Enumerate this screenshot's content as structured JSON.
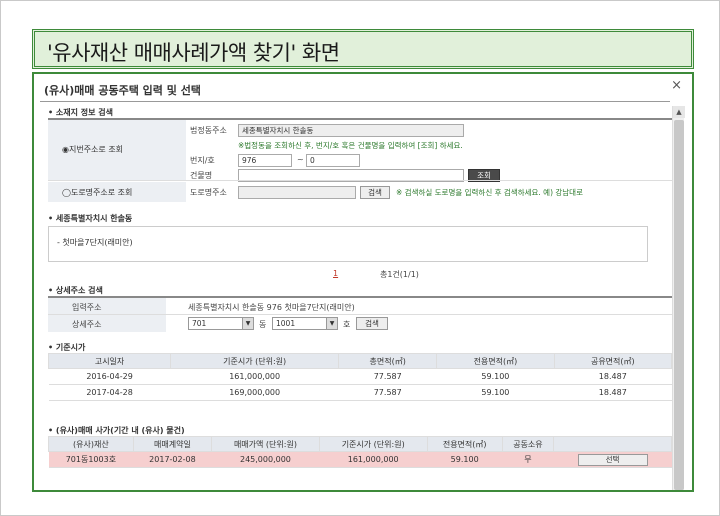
{
  "slide_title": "'유사재산 매매사례가액 찾기' 화면",
  "dialog": {
    "title": "(유사)매매 공동주택 입력 및 선택",
    "close": "×"
  },
  "section_location": {
    "title": "소재지 정보 검색",
    "radio_jibun": "◉지번주소로 조회",
    "radio_road": "◯도로명주소로 조회",
    "label_legal_dong": "법정동주소",
    "legal_dong_value": "세종특별자치시 한솔동",
    "hint_jibun": "※법정동을 조회하신 후, 번지/호 혹은 건물명을 입력하여 [조회] 하세요.",
    "label_bunji": "번지/호",
    "bunji_value": "976",
    "dash": "~",
    "ho_value": "0",
    "label_building": "건물명",
    "building_value": "",
    "search_button": "조회",
    "label_road": "도로명주소",
    "road_value": "",
    "road_search_button": "검색",
    "hint_road": "※ 검색하실 도로명을 입력하신 후 검색하세요. 예) 강남대로"
  },
  "section_region": {
    "title": "세종특별자치시 한솔동",
    "list_item": "- 첫마을7단지(래미안)",
    "page_marker": "1",
    "page_count": "총1건(1/1)"
  },
  "section_detail": {
    "title": "상세주소 검색",
    "label_input_address": "입력주소",
    "input_address_value": "세종특별자치시 한솔동 976 첫마을7단지(래미안)",
    "label_detail_address": "상세주소",
    "dong_value": "701",
    "dong_unit": "동",
    "ho_value": "1001",
    "ho_unit": "호",
    "search_button": "검색"
  },
  "section_standard": {
    "title": "기준시가",
    "columns": [
      "고시일자",
      "기준시가 (단위:원)",
      "총면적(㎡)",
      "전용면적(㎡)",
      "공유면적(㎡)"
    ],
    "rows": [
      [
        "2016-04-29",
        "161,000,000",
        "77.587",
        "59.100",
        "18.487"
      ],
      [
        "2017-04-28",
        "169,000,000",
        "77.587",
        "59.100",
        "18.487"
      ]
    ]
  },
  "section_similar": {
    "title": "(유사)매매 사가(기간 내 (유사) 물건)",
    "columns": [
      "(유사)재산",
      "매매계약일",
      "매매가액 (단위:원)",
      "기준시가 (단위:원)",
      "전용면적(㎡)",
      "공동소유",
      ""
    ],
    "rows": [
      [
        "701동1003호",
        "2017-02-08",
        "245,000,000",
        "161,000,000",
        "59.100",
        "무",
        "선택"
      ]
    ]
  },
  "colors": {
    "title_green": "#3e8a3a",
    "title_bg": "#e1f0da",
    "highlight_row": "#f6cfcf",
    "hint_green": "#2d7a2d"
  }
}
